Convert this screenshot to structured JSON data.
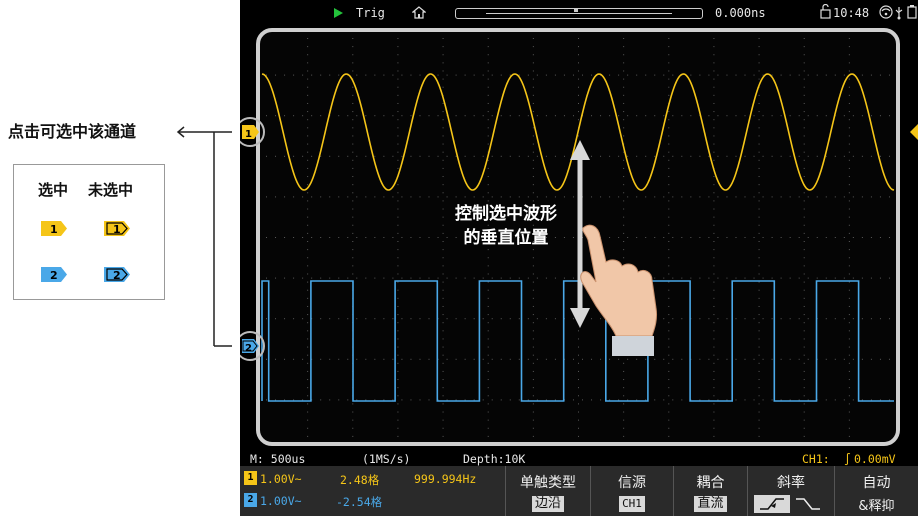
{
  "annotations": {
    "channel_select_hint": "点击可选中该通道",
    "legend_selected": "选中",
    "legend_unselected": "未选中",
    "drag_hint_line1": "控制选中波形",
    "drag_hint_line2": "的垂直位置"
  },
  "topbar": {
    "trigger_status": "Trig",
    "trigger_time": "0.000ns",
    "clock": "10:48",
    "icons": [
      "play-icon",
      "home-icon",
      "lock-icon",
      "wifi-icon",
      "usb-icon",
      "battery-icon"
    ]
  },
  "bottom_info": {
    "timebase": "M: 500us",
    "sample_rate": "(1MS/s)",
    "depth": "Depth:10K",
    "trigger_info": "CH1:",
    "trigger_level": "0.00mV"
  },
  "channels": [
    {
      "number": "1",
      "volts_div": "1.00V~",
      "offset": "2.48格",
      "freq": "999.994Hz",
      "color": "#f5c518"
    },
    {
      "number": "2",
      "volts_div": "1.00V~",
      "offset": "-2.54格",
      "color": "#4aa8e8"
    }
  ],
  "menu": {
    "trigger_type": {
      "title": "单触类型",
      "value": "边沿"
    },
    "source": {
      "title": "信源",
      "value": "CH1"
    },
    "coupling": {
      "title": "耦合",
      "value": "直流"
    },
    "slope": {
      "title": "斜率"
    },
    "mode": {
      "title": "自动",
      "value": "&释抑"
    }
  },
  "colors": {
    "ch1": "#f5c518",
    "ch2": "#4aa8e8",
    "grid": "#5a5a5a",
    "background": "#000000"
  },
  "waveforms": {
    "ch1": {
      "shape": "sine",
      "cycles_visible": 7.5
    },
    "ch2": {
      "shape": "square",
      "cycles_visible": 7.5
    }
  }
}
